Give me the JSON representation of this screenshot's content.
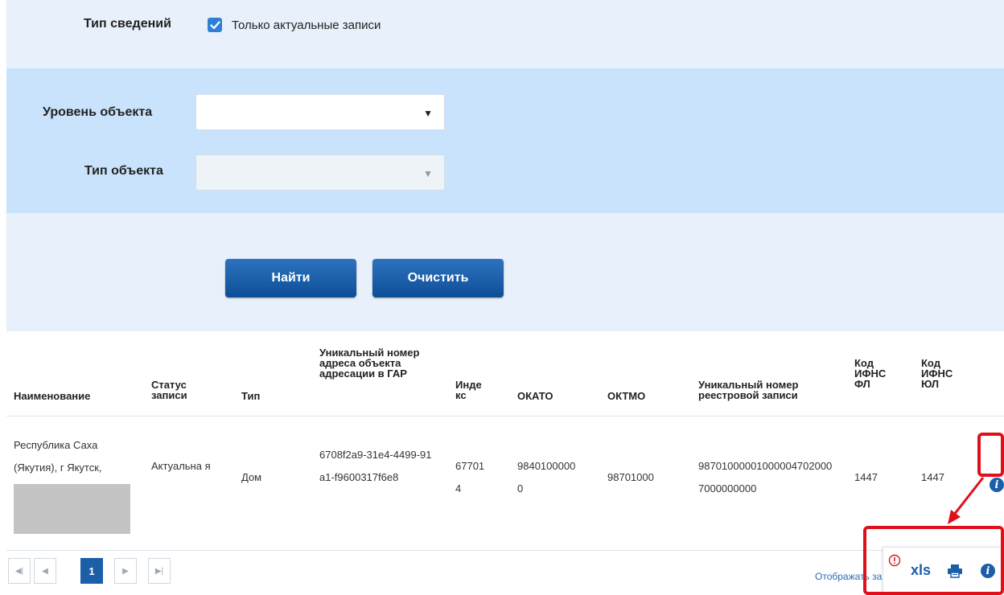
{
  "filters": {
    "info_type_label": "Тип сведений",
    "only_actual_label": "Только актуальные записи",
    "only_actual_checked": true,
    "object_level_label": "Уровень объекта",
    "object_level_value": "",
    "object_type_label": "Тип объекта",
    "object_type_value": ""
  },
  "buttons": {
    "find": "Найти",
    "clear": "Очистить"
  },
  "table": {
    "headers": [
      "Наименование",
      "Статус записи",
      "Тип",
      "Уникальный номер адреса объекта адресации в ГАР",
      "Инде кс",
      "ОКАТО",
      "ОКТМО",
      "Уникальный номер реестровой записи",
      "Код ИФНС ФЛ",
      "Код ИФНС ЮЛ"
    ],
    "rows": [
      {
        "name": "Республика Саха (Якутия), г Якутск,",
        "status": "Актуальна я",
        "type": "Дом",
        "gar": "6708f2a9-31e4-4499-91a1-f9600317f6e8",
        "index": "677014",
        "okato": "98401000000",
        "oktmo": "98701000",
        "reg": "987010000010000047020007000000000",
        "ifns_fl": "1447",
        "ifns_ul": "1447"
      }
    ]
  },
  "pager": {
    "current_page": "1"
  },
  "popup": {
    "xls_label": "xls"
  },
  "footer": {
    "display_text": "Отображать записи"
  }
}
